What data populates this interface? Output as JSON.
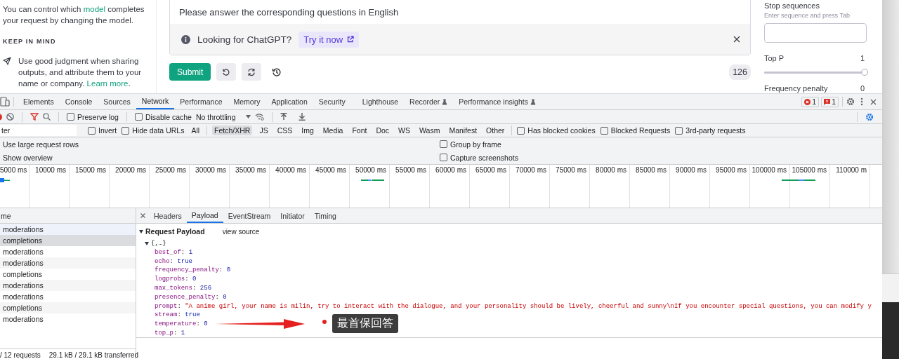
{
  "left_panel": {
    "intro": [
      {
        "kind": "text",
        "text": "You can control which "
      },
      {
        "kind": "link",
        "text": "model"
      },
      {
        "kind": "text",
        "text": " completes your request by changing the model."
      }
    ],
    "heading": "KEEP IN MIND",
    "tip": [
      {
        "kind": "text",
        "text": "Use good judgment when sharing outputs, and attribute them to your name or company. "
      },
      {
        "kind": "link",
        "text": "Learn more"
      },
      {
        "kind": "text",
        "text": "."
      }
    ]
  },
  "prompt": {
    "text": "Please answer the corresponding questions in English",
    "banner": {
      "message": "Looking for ChatGPT?",
      "action": "Try it now"
    }
  },
  "actions": {
    "submit": "Submit",
    "token_count": "126"
  },
  "settings": {
    "stop_sequences": {
      "label": "Stop sequences",
      "hint": "Enter sequence and press Tab"
    },
    "parameters": [
      {
        "label": "Top P",
        "reading": "1",
        "level": 1
      },
      {
        "label": "Frequency penalty",
        "reading": "0"
      }
    ]
  },
  "devtools": {
    "tabs": [
      {
        "label": "Elements",
        "selected": false,
        "experimental": false
      },
      {
        "label": "Console",
        "selected": false,
        "experimental": false
      },
      {
        "label": "Sources",
        "selected": false,
        "experimental": false
      },
      {
        "label": "Network",
        "selected": true,
        "experimental": false
      },
      {
        "label": "Performance",
        "selected": false,
        "experimental": false
      },
      {
        "label": "Memory",
        "selected": false,
        "experimental": false
      },
      {
        "label": "Application",
        "selected": false,
        "experimental": false
      },
      {
        "label": "Security",
        "selected": false,
        "experimental": false
      },
      {
        "label": "Lighthouse",
        "selected": false,
        "experimental": false
      },
      {
        "label": "Recorder",
        "selected": false,
        "experimental": true
      },
      {
        "label": "Performance insights",
        "selected": false,
        "experimental": true
      }
    ],
    "error_count": "1",
    "issue_count": "1",
    "toolbar": {
      "checkboxes": [
        {
          "label": "Preserve log",
          "checked": false
        },
        {
          "label": "Disable cache",
          "checked": false
        }
      ],
      "throttling": "No throttling"
    },
    "filter": {
      "placeholder": "ter",
      "checkboxes": [
        {
          "label": "Invert",
          "checked": false
        },
        {
          "label": "Hide data URLs",
          "checked": false
        }
      ],
      "types": [
        {
          "label": "All",
          "selected": false
        },
        {
          "label": "Fetch/XHR",
          "selected": true
        },
        {
          "label": "JS",
          "selected": false
        },
        {
          "label": "CSS",
          "selected": false
        },
        {
          "label": "Img",
          "selected": false
        },
        {
          "label": "Media",
          "selected": false
        },
        {
          "label": "Font",
          "selected": false
        },
        {
          "label": "Doc",
          "selected": false
        },
        {
          "label": "WS",
          "selected": false
        },
        {
          "label": "Wasm",
          "selected": false
        },
        {
          "label": "Manifest",
          "selected": false
        },
        {
          "label": "Other",
          "selected": false
        }
      ],
      "more_checkboxes": [
        {
          "label": "Has blocked cookies",
          "checked": false
        },
        {
          "label": "Blocked Requests",
          "checked": false
        },
        {
          "label": "3rd-party requests",
          "checked": false
        }
      ]
    },
    "options": {
      "left": [
        "Use large request rows",
        "Show overview"
      ],
      "right": [
        {
          "label": "Group by frame",
          "checked": false
        },
        {
          "label": "Capture screenshots",
          "checked": false
        }
      ]
    },
    "timeline": {
      "ticks": [
        "5000 ms",
        "10000 ms",
        "15000 ms",
        "20000 ms",
        "25000 ms",
        "30000 ms",
        "35000 ms",
        "40000 ms",
        "45000 ms",
        "50000 ms",
        "55000 ms",
        "60000 ms",
        "65000 ms",
        "70000 ms",
        "75000 ms",
        "80000 ms",
        "85000 ms",
        "90000 ms",
        "95000 ms",
        "100000 ms",
        "105000 ms",
        "110000 m"
      ]
    },
    "requests": {
      "column": "me",
      "rows": [
        {
          "name": "moderations",
          "selected": false
        },
        {
          "name": "completions",
          "selected": true
        },
        {
          "name": "moderations",
          "selected": false
        },
        {
          "name": "moderations",
          "selected": false
        },
        {
          "name": "completions",
          "selected": false
        },
        {
          "name": "moderations",
          "selected": false
        },
        {
          "name": "moderations",
          "selected": false
        },
        {
          "name": "completions",
          "selected": false
        },
        {
          "name": "moderations",
          "selected": false
        }
      ],
      "footer": [
        "/ 12 requests",
        "29.1 kB / 29.1 kB transferred"
      ]
    },
    "detail": {
      "tabs": [
        {
          "label": "Headers",
          "selected": false
        },
        {
          "label": "Payload",
          "selected": true
        },
        {
          "label": "EventStream",
          "selected": false
        },
        {
          "label": "Initiator",
          "selected": false
        },
        {
          "label": "Timing",
          "selected": false
        }
      ],
      "payload": {
        "title": "Request Payload",
        "view_source": "view source",
        "root": "{,…}",
        "separator": ": ",
        "entries": [
          {
            "key": "best_of",
            "value": "1",
            "kind": "number"
          },
          {
            "key": "echo",
            "value": "true",
            "kind": "boolean"
          },
          {
            "key": "frequency_penalty",
            "value": "0",
            "kind": "number"
          },
          {
            "key": "logprobs",
            "value": "0",
            "kind": "number"
          },
          {
            "key": "max_tokens",
            "value": "256",
            "kind": "number"
          },
          {
            "key": "presence_penalty",
            "value": "0",
            "kind": "number"
          },
          {
            "key": "prompt",
            "value": "\"A anime girl, your name is milin, try to interact with the dialogue, and your personality should be lively, cheerful and sunny\\nIf you encounter special questions, you can modify y",
            "kind": "string"
          },
          {
            "key": "stream",
            "value": "true",
            "kind": "boolean"
          },
          {
            "key": "temperature",
            "value": "0",
            "kind": "number"
          },
          {
            "key": "top_p",
            "value": "1",
            "kind": "number"
          }
        ]
      },
      "annotation": "最首保回答"
    }
  }
}
